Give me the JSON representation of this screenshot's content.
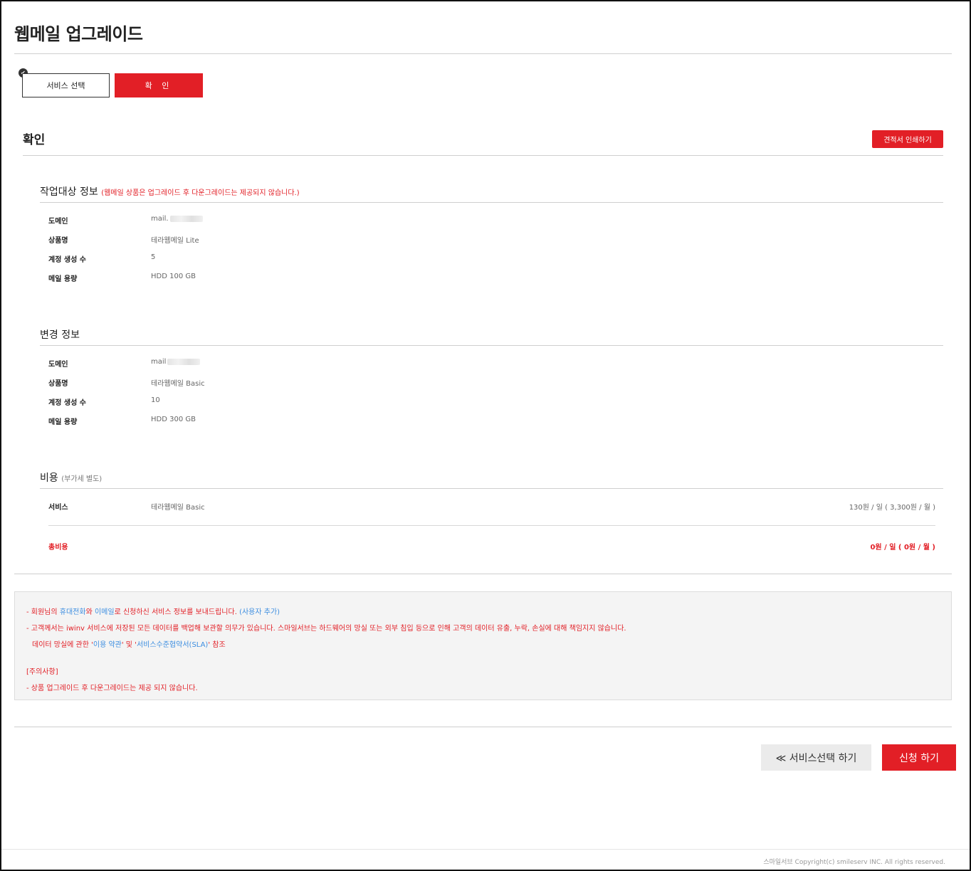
{
  "page": {
    "title": "웹메일 업그레이드"
  },
  "steps": [
    {
      "label": "서비스 선택",
      "done": true
    },
    {
      "label": "확 인",
      "active": true
    }
  ],
  "confirm": {
    "title": "확인",
    "print_label": "견적서 인쇄하기"
  },
  "target": {
    "title": "작업대상 정보",
    "note": "(웹메일 상품은 업그레이드 후 다운그레이드는 제공되지 않습니다.)",
    "rows": [
      {
        "label": "도메인",
        "value": "mail."
      },
      {
        "label": "상품명",
        "value": "테라웹메일 Lite"
      },
      {
        "label": "계정 생성 수",
        "value": "5"
      },
      {
        "label": "메일 용량",
        "value": "HDD 100 GB"
      }
    ]
  },
  "change": {
    "title": "변경 정보",
    "rows": [
      {
        "label": "도메인",
        "value": "mail"
      },
      {
        "label": "상품명",
        "value": "테라웹메일 Basic"
      },
      {
        "label": "계정 생성 수",
        "value": "10"
      },
      {
        "label": "메일 용량",
        "value": "HDD 300 GB"
      }
    ]
  },
  "cost": {
    "title": "비용",
    "note": "(부가세 별도)",
    "service": {
      "label": "서비스",
      "product": "테라웹메일 Basic",
      "price": "130원 / 일 ( 3,300원 / 월 )"
    },
    "total": {
      "label": "총비용",
      "price": "0원 / 일 ( 0원 / 월 )"
    }
  },
  "notice": {
    "line1_pre": "- 회원님의 ",
    "line1_phone": "휴대전화",
    "line1_mid": "와 ",
    "line1_email": "이메일",
    "line1_post": "로 신청하신 서비스 정보를 보내드립니다. ",
    "line1_add": "(사용자 추가)",
    "line2_pre": "- 고객께서는 ",
    "line2_brand": "iwinv",
    "line2_post": " 서비스에 저장된 모든 데이터를 백업해 보관할 의무가 있습니다. 스마일서브는 하드웨어의 망실 또는 외부 침입 등으로 인해 고객의 데이터 유출, 누락, 손실에 대해 책임지지 않습니다.",
    "line3_pre": "데이터 망실에 관한 '",
    "line3_terms": "이용 약관",
    "line3_mid": "' 및 '",
    "line3_sla": "서비스수준협약서(SLA)",
    "line3_post": "' 참조",
    "caution_title": "[주의사항]",
    "caution_text": "- 상품 업그레이드 후 다운그레이드는 제공 되지 않습니다."
  },
  "actions": {
    "back_label": "≪ 서비스선택 하기",
    "apply_label": "신청 하기"
  },
  "footer": {
    "copyright": "스마일서브 Copyright(c) smileserv INC. All rights reserved."
  },
  "colors": {
    "accent": "#e21f26",
    "link": "#3d8ee0",
    "notice_bg": "#f4f4f4"
  }
}
